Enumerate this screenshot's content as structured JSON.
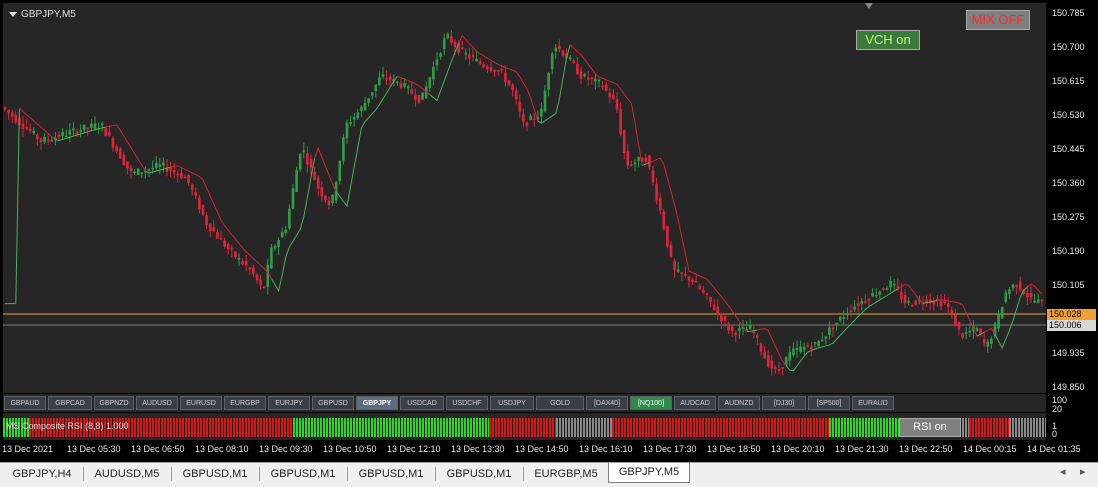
{
  "chart": {
    "title": "GBPJPY,M5",
    "buttons": {
      "mix": "MIX OFF",
      "vch": "VCH on"
    },
    "price_axis": [
      "150.785",
      "150.700",
      "150.615",
      "150.530",
      "150.445",
      "150.360",
      "150.275",
      "150.190",
      "150.105",
      "150.020",
      "149.935",
      "149.850"
    ],
    "price_tags": {
      "orange": "150.028",
      "gray": "150.006"
    },
    "colors": {
      "bull": "#2e9e47",
      "bear": "#e0243c",
      "ma": "#d8203a",
      "ma2": "#49b35a",
      "orange_line": "#f0a030"
    }
  },
  "symbols": [
    "GBPAUD",
    "GBPCAD",
    "GBPNZD",
    "AUDUSD",
    "EURUSD",
    "EURGBP",
    "EURJPY",
    "GBPUSD",
    "GBPJPY",
    "USDCAD",
    "USDCHF",
    "USDJPY",
    "GOLD",
    "[DAX40]",
    "[NQ100]",
    "AUDCAD",
    "AUDNZD",
    "[DJ30]",
    "[SP500]",
    "EURAUD"
  ],
  "indicator": {
    "label": "MS Composite RSI (8,8) 1.000",
    "button": "RSI on",
    "axis": [
      "100",
      "20",
      "1",
      "0"
    ]
  },
  "time_axis": [
    "13 Dec 2021",
    "13 Dec 05:30",
    "13 Dec 06:50",
    "13 Dec 08:10",
    "13 Dec 09:30",
    "13 Dec 10:50",
    "13 Dec 12:10",
    "13 Dec 13:30",
    "13 Dec 14:50",
    "13 Dec 16:10",
    "13 Dec 17:30",
    "13 Dec 18:50",
    "13 Dec 20:10",
    "13 Dec 21:30",
    "13 Dec 22:50",
    "14 Dec 00:15",
    "14 Dec 01:35"
  ],
  "tabs": [
    "GBPJPY,H4",
    "AUDUSD,M5",
    "GBPUSD,M1",
    "GBPUSD,M1",
    "GBPUSD,M1",
    "GBPUSD,M1",
    "EURGBP,M5",
    "GBPJPY,M5"
  ],
  "active_tab": "GBPJPY,M5",
  "tab_nav": {
    "prev": "◂",
    "next": "▸"
  }
}
